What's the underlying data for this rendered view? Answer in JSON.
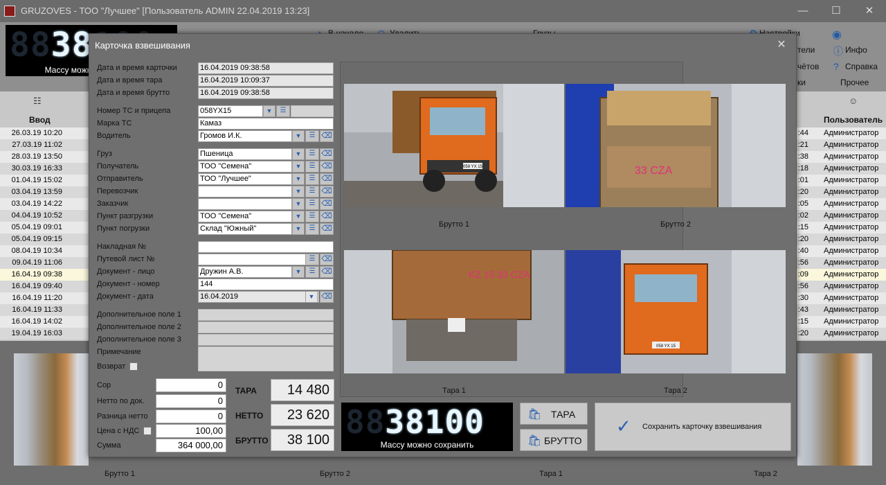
{
  "window": {
    "title": "GRUZOVES - ТОО \"Лучшее\" [Пользователь ADMIN 22.04.2019 13:23]"
  },
  "ribbon": {
    "display_caption": "Массу можно сохранить",
    "items": {
      "start": "В начало",
      "delete": "Удалить",
      "cargo": "Грузы",
      "settings": "Настройки",
      "partial1": "тели",
      "partial2": "чётов",
      "partial3": "ки",
      "info": "Инфо",
      "help": "Справка",
      "other_group": "Прочее"
    }
  },
  "table": {
    "col_entry": "Ввод",
    "col_user": "Пользователь",
    "rows": [
      {
        "date": "26.03.19 10:20",
        "mid": ":44",
        "user": "Администратор"
      },
      {
        "date": "27.03.19 11:02",
        "mid": ":21",
        "user": "Администратор"
      },
      {
        "date": "28.03.19 13:50",
        "mid": ":38",
        "user": "Администратор"
      },
      {
        "date": "30.03.19 16:33",
        "mid": ":18",
        "user": "Администратор"
      },
      {
        "date": "01.04.19 15:02",
        "mid": ":01",
        "user": "Администратор"
      },
      {
        "date": "03.04.19 13:59",
        "mid": ":20",
        "user": "Администратор"
      },
      {
        "date": "03.04.19 14:22",
        "mid": ":05",
        "user": "Администратор"
      },
      {
        "date": "04.04.19 10:52",
        "mid": ":02",
        "user": "Администратор"
      },
      {
        "date": "05.04.19 09:01",
        "mid": ":15",
        "user": "Администратор"
      },
      {
        "date": "05.04.19 09:15",
        "mid": ":20",
        "user": "Администратор"
      },
      {
        "date": "08.04.19 10:34",
        "mid": ":40",
        "user": "Администратор"
      },
      {
        "date": "09.04.19 11:06",
        "mid": ":56",
        "user": "Администратор"
      },
      {
        "date": "16.04.19 09:38",
        "mid": ":09",
        "user": "Администратор"
      },
      {
        "date": "16.04.19 09:40",
        "mid": ":56",
        "user": "Администратор"
      },
      {
        "date": "16.04.19 11:20",
        "mid": ":30",
        "user": "Администратор"
      },
      {
        "date": "16.04.19 11:33",
        "mid": ":43",
        "user": "Администратор"
      },
      {
        "date": "16.04.19 14:02",
        "mid": ":15",
        "user": "Администратор"
      },
      {
        "date": "19.04.19 16:03",
        "mid": ":20",
        "user": "Администратор"
      }
    ]
  },
  "bottom_strip": {
    "captions": [
      "Брутто 1",
      "Брутто 2",
      "Тара 1",
      "Тара 2"
    ]
  },
  "dialog": {
    "title": "Карточка взвешивания",
    "fields": {
      "card_datetime_label": "Дата и время карточки",
      "card_datetime": "16.04.2019 09:38:58",
      "tare_datetime_label": "Дата и время тара",
      "tare_datetime": "16.04.2019 10:09:37",
      "gross_datetime_label": "Дата и время брутто",
      "gross_datetime": "16.04.2019 09:38:58",
      "vehicle_no_label": "Номер ТС и прицепа",
      "vehicle_no": "058YX15",
      "vehicle_brand_label": "Марка ТС",
      "vehicle_brand": "Камаз",
      "driver_label": "Водитель",
      "driver": "Громов И.К.",
      "cargo_label": "Груз",
      "cargo": "Пшеница",
      "receiver_label": "Получатель",
      "receiver": "ТОО \"Семена\"",
      "sender_label": "Отправитель",
      "sender": "ТОО \"Лучшее\"",
      "carrier_label": "Перевозчик",
      "carrier": "",
      "customer_label": "Заказчик",
      "customer": "",
      "unload_point_label": "Пункт разгрузки",
      "unload_point": "ТОО \"Семена\"",
      "load_point_label": "Пункт погрузки",
      "load_point": "Склад \"Южный\"",
      "invoice_label": "Накладная №",
      "invoice": "",
      "waybill_label": "Путевой лист №",
      "waybill": "",
      "doc_person_label": "Документ - лицо",
      "doc_person": "Дружин А.В.",
      "doc_number_label": "Документ - номер",
      "doc_number": "144",
      "doc_date_label": "Документ - дата",
      "doc_date": "16.04.2019",
      "extra1_label": "Дополнительное поле 1",
      "extra2_label": "Дополнительное поле 2",
      "extra3_label": "Дополнительное поле 3",
      "note_label": "Примечание",
      "return_label": "Возврат",
      "sor_label": "Сор",
      "sor": "0",
      "net_doc_label": "Нетто по док.",
      "net_doc": "0",
      "net_diff_label": "Разница нетто",
      "net_diff": "0",
      "price_label": "Цена с НДС",
      "price": "100,00",
      "sum_label": "Сумма",
      "sum": "364 000,00"
    },
    "weights": {
      "tare_label": "ТАРА",
      "tare": "14 480",
      "net_label": "НЕТТО",
      "net": "23 620",
      "gross_label": "БРУТТО",
      "gross": "38 100"
    },
    "photos": {
      "captions": [
        "Брутто 1",
        "Брутто 2",
        "Тара 1",
        "Тара 2"
      ],
      "plates": [
        "058 YX 15",
        "33 CZA",
        "KZ 15 33 CZA",
        "058 YX 15"
      ]
    },
    "display": {
      "digits": "38100",
      "caption": "Массу можно сохранить"
    },
    "buttons": {
      "tare": "ТАРА",
      "gross": "БРУТТО",
      "save": "Сохранить карточку взвешивания"
    }
  },
  "colors": {
    "icon_blue": "#2a5fb0",
    "truck_orange": "#e06a1e",
    "display_lit": "#e8f6ff"
  }
}
